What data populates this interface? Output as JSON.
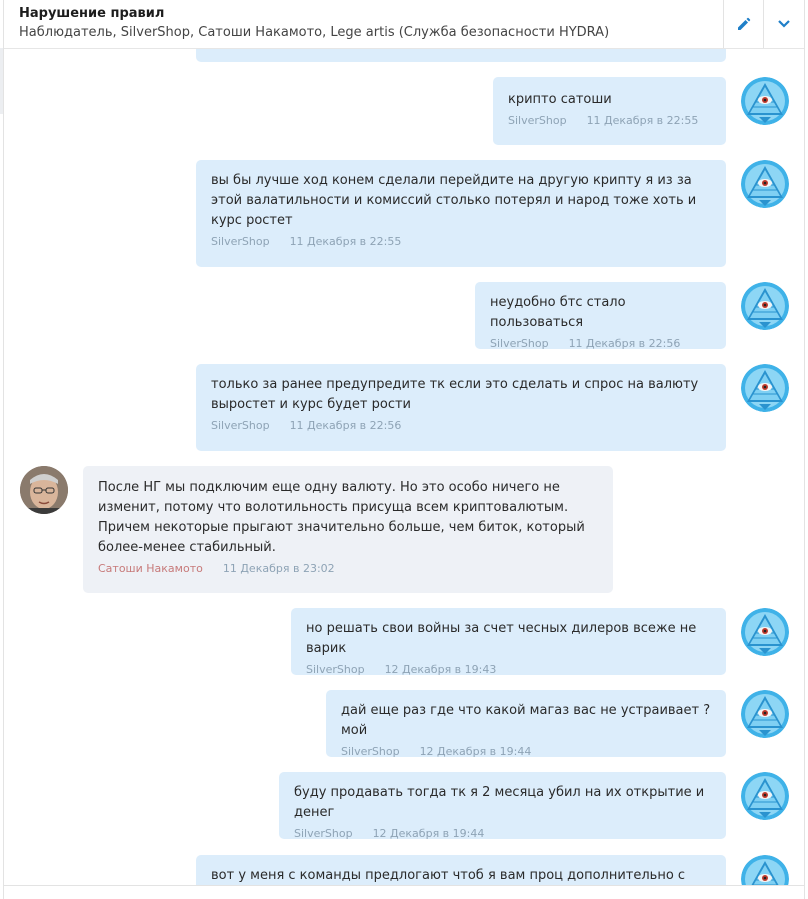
{
  "header": {
    "title": "Нарушение правил",
    "participants": "Наблюдатель, SilverShop, Сатоши Накамото, Lege artis (Служба безопасности HYDRA)"
  },
  "messages": [
    {
      "text": "крипто сатоши",
      "author": "SilverShop",
      "time": "11 Декабря в 22:55"
    },
    {
      "text": "вы бы лучше ход конем сделали перейдите на другую крипту я из за этой валатильности и комиссий столько потерял и народ тоже хоть и курс ростет",
      "author": "SilverShop",
      "time": "11 Декабря в 22:55"
    },
    {
      "text": "неудобно бтс стало пользоваться",
      "author": "SilverShop",
      "time": "11 Декабря в 22:56"
    },
    {
      "text": "только за ранее предупредите тк если это сделать и спрос на валюту выростет и курс будет рости",
      "author": "SilverShop",
      "time": "11 Декабря в 22:56"
    },
    {
      "text": "После НГ мы подключим еще одну валюту. Но это особо ничего не изменит, потому что волотильность присуща всем криптовалютым. Причем некоторые прыгают значительно больше, чем биток, который более-менее стабильный.",
      "author": "Сатоши Накамото",
      "time": "11 Декабря в 23:02"
    },
    {
      "text": "но решать свои войны за счет чесных дилеров всеже не варик",
      "author": "SilverShop",
      "time": "12 Декабря в 19:43"
    },
    {
      "text": "дай еще раз где что какой магаз вас не устраивает ? мой",
      "author": "SilverShop",
      "time": "12 Декабря в 19:44"
    },
    {
      "text": "буду продавать тогда тк я 2 месяца убил на их открытие и денег",
      "author": "SilverShop",
      "time": "12 Декабря в 19:44"
    },
    {
      "text": "вот у меня с команды предлогают чтоб я вам проц дополнительно с продаж",
      "author": "",
      "time": ""
    }
  ],
  "icons": {
    "edit": "pencil-icon",
    "expand": "chevron-down-icon",
    "own_avatar": "pyramid-eye-avatar",
    "other_avatar": "person-photo-avatar"
  },
  "colors": {
    "accent": "#1f7fc8",
    "outgoing_bubble": "#dcedfb",
    "incoming_bubble": "#eef1f6",
    "meta": "#8ea3b5",
    "author_highlight": "#c77a7a"
  }
}
